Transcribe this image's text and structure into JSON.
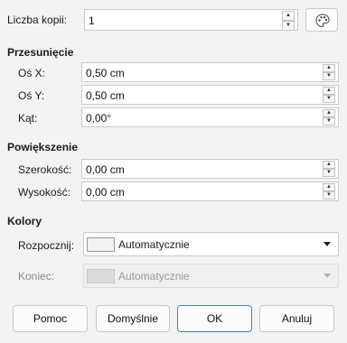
{
  "copies": {
    "label": "Liczba kopii:",
    "value": "1",
    "button_icon": "palette-icon"
  },
  "offset": {
    "title": "Przesunięcie",
    "x_label": "Oś X:",
    "x_value": "0,50 cm",
    "y_label": "Oś Y:",
    "y_value": "0,50 cm",
    "angle_label": "Kąt:",
    "angle_value": "0,00°"
  },
  "enlargement": {
    "title": "Powiększenie",
    "width_label": "Szerokość:",
    "width_value": "0,00 cm",
    "height_label": "Wysokość:",
    "height_value": "0,00 cm"
  },
  "colors": {
    "title": "Kolory",
    "start_label": "Rozpocznij:",
    "start_value": "Automatycznie",
    "end_label": "Koniec:",
    "end_value": "Automatycznie"
  },
  "buttons": {
    "help": "Pomoc",
    "reset": "Domyślnie",
    "ok": "OK",
    "cancel": "Anuluj"
  }
}
